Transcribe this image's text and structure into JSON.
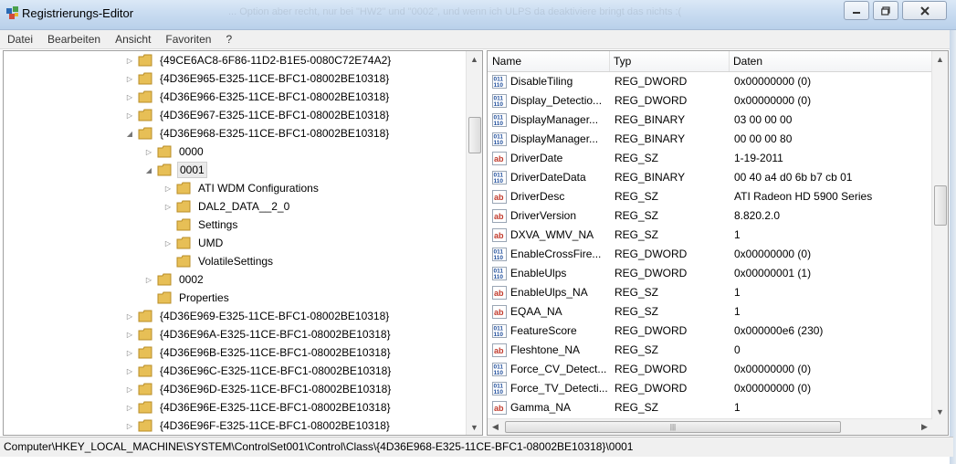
{
  "window": {
    "title": "Registrierungs-Editor",
    "title_overlay": "... Option aber recht, nur bei \"HW2\" und \"0002\", und wenn ich ULPS da deaktiviere bringt das nichts :(",
    "controls": {
      "minimize": "minimize-icon",
      "maximize": "maximize-icon",
      "close": "close-icon"
    }
  },
  "menu": [
    "Datei",
    "Bearbeiten",
    "Ansicht",
    "Favoriten",
    "?"
  ],
  "tree": {
    "items": [
      {
        "label": "{49CE6AC8-6F86-11D2-B1E5-0080C72E74A2}",
        "expander": "▷"
      },
      {
        "label": "{4D36E965-E325-11CE-BFC1-08002BE10318}",
        "expander": "▷"
      },
      {
        "label": "{4D36E966-E325-11CE-BFC1-08002BE10318}",
        "expander": "▷"
      },
      {
        "label": "{4D36E967-E325-11CE-BFC1-08002BE10318}",
        "expander": "▷"
      },
      {
        "label": "{4D36E968-E325-11CE-BFC1-08002BE10318}",
        "expander": "◢"
      },
      {
        "label": "0000",
        "expander": "▷"
      },
      {
        "label": "0001",
        "expander": "◢"
      },
      {
        "label": "ATI WDM Configurations",
        "expander": "▷"
      },
      {
        "label": "DAL2_DATA__2_0",
        "expander": "▷"
      },
      {
        "label": "Settings",
        "expander": ""
      },
      {
        "label": "UMD",
        "expander": "▷"
      },
      {
        "label": "VolatileSettings",
        "expander": ""
      },
      {
        "label": "0002",
        "expander": "▷"
      },
      {
        "label": "Properties",
        "expander": ""
      },
      {
        "label": "{4D36E969-E325-11CE-BFC1-08002BE10318}",
        "expander": "▷"
      },
      {
        "label": "{4D36E96A-E325-11CE-BFC1-08002BE10318}",
        "expander": "▷"
      },
      {
        "label": "{4D36E96B-E325-11CE-BFC1-08002BE10318}",
        "expander": "▷"
      },
      {
        "label": "{4D36E96C-E325-11CE-BFC1-08002BE10318}",
        "expander": "▷"
      },
      {
        "label": "{4D36E96D-E325-11CE-BFC1-08002BE10318}",
        "expander": "▷"
      },
      {
        "label": "{4D36E96E-E325-11CE-BFC1-08002BE10318}",
        "expander": "▷"
      },
      {
        "label": "{4D36E96F-E325-11CE-BFC1-08002BE10318}",
        "expander": "▷"
      }
    ],
    "selected": "0001",
    "scroll_arrows": {
      "up": "▲",
      "down": "▼"
    }
  },
  "list": {
    "columns": [
      "Name",
      "Typ",
      "Daten"
    ],
    "rows": [
      {
        "name": "DisableTiling",
        "type": "REG_DWORD",
        "data": "0x00000000 (0)",
        "icon": "binary-value-icon"
      },
      {
        "name": "Display_Detectio...",
        "type": "REG_DWORD",
        "data": "0x00000000 (0)",
        "icon": "binary-value-icon"
      },
      {
        "name": "DisplayManager...",
        "type": "REG_BINARY",
        "data": "03 00 00 00",
        "icon": "binary-value-icon"
      },
      {
        "name": "DisplayManager...",
        "type": "REG_BINARY",
        "data": "00 00 00 80",
        "icon": "binary-value-icon"
      },
      {
        "name": "DriverDate",
        "type": "REG_SZ",
        "data": "1-19-2011",
        "icon": "string-value-icon"
      },
      {
        "name": "DriverDateData",
        "type": "REG_BINARY",
        "data": "00 40 a4 d0 6b b7 cb 01",
        "icon": "binary-value-icon"
      },
      {
        "name": "DriverDesc",
        "type": "REG_SZ",
        "data": "ATI Radeon HD 5900 Series",
        "icon": "string-value-icon"
      },
      {
        "name": "DriverVersion",
        "type": "REG_SZ",
        "data": "8.820.2.0",
        "icon": "string-value-icon"
      },
      {
        "name": "DXVA_WMV_NA",
        "type": "REG_SZ",
        "data": "1",
        "icon": "string-value-icon"
      },
      {
        "name": "EnableCrossFire...",
        "type": "REG_DWORD",
        "data": "0x00000000 (0)",
        "icon": "binary-value-icon"
      },
      {
        "name": "EnableUlps",
        "type": "REG_DWORD",
        "data": "0x00000001 (1)",
        "icon": "binary-value-icon"
      },
      {
        "name": "EnableUlps_NA",
        "type": "REG_SZ",
        "data": "1",
        "icon": "string-value-icon"
      },
      {
        "name": "EQAA_NA",
        "type": "REG_SZ",
        "data": "1",
        "icon": "string-value-icon"
      },
      {
        "name": "FeatureScore",
        "type": "REG_DWORD",
        "data": "0x000000e6 (230)",
        "icon": "binary-value-icon"
      },
      {
        "name": "Fleshtone_NA",
        "type": "REG_SZ",
        "data": "0",
        "icon": "string-value-icon"
      },
      {
        "name": "Force_CV_Detect...",
        "type": "REG_DWORD",
        "data": "0x00000000 (0)",
        "icon": "binary-value-icon"
      },
      {
        "name": "Force_TV_Detecti...",
        "type": "REG_DWORD",
        "data": "0x00000000 (0)",
        "icon": "binary-value-icon"
      },
      {
        "name": "Gamma_NA",
        "type": "REG_SZ",
        "data": "1",
        "icon": "string-value-icon"
      }
    ],
    "icon_glyphs": {
      "string": "ab",
      "binary": "011\n110"
    },
    "scroll_arrows": {
      "up": "▲",
      "down": "▼",
      "left": "◀",
      "right": "▶",
      "grip": "|||"
    }
  },
  "status": {
    "path": "Computer\\HKEY_LOCAL_MACHINE\\SYSTEM\\ControlSet001\\Control\\Class\\{4D36E968-E325-11CE-BFC1-08002BE10318}\\0001"
  }
}
